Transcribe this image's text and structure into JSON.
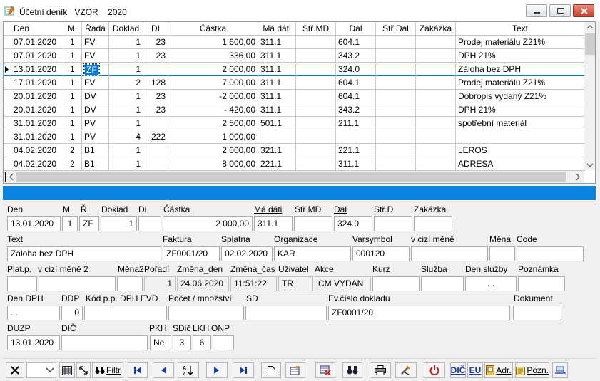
{
  "window": {
    "title": "Účetní deník   VZOR    2020"
  },
  "grid": {
    "columns": [
      "Den",
      "M.",
      "Řada",
      "Doklad",
      "DI",
      "Částka",
      "Má dáti",
      "Stř.MD",
      "Dal",
      "Stř.Dal",
      "Zakázka",
      "Text"
    ],
    "rows": [
      [
        "07.01.2020",
        "1",
        "FV",
        "1",
        "23",
        "1 600,00",
        "311.1",
        "",
        "604.1",
        "",
        "",
        "Prodej materiálu Z21%"
      ],
      [
        "07.01.2020",
        "1",
        "FV",
        "1",
        "23",
        "336,00",
        "311.1",
        "",
        "343.2",
        "",
        "",
        "DPH 21%"
      ],
      [
        "13.01.2020",
        "1",
        "ZF",
        "1",
        "",
        "2 000,00",
        "311.1",
        "",
        "324.0",
        "",
        "",
        "Záloha bez DPH"
      ],
      [
        "17.01.2020",
        "1",
        "FV",
        "2",
        "128",
        "7 000,00",
        "311.1",
        "",
        "604.1",
        "",
        "",
        "Prodej materiálu Z21%"
      ],
      [
        "20.01.2020",
        "1",
        "DV",
        "1",
        "23",
        "-2 000,00",
        "311.1",
        "",
        "604.1",
        "",
        "",
        "Dobropis vydaný Z21%"
      ],
      [
        "20.01.2020",
        "1",
        "DV",
        "1",
        "23",
        "- 420,00",
        "311.1",
        "",
        "343.2",
        "",
        "",
        "DPH 21%"
      ],
      [
        "31.01.2020",
        "1",
        "PV",
        "1",
        "",
        "2 500,00",
        "501.1",
        "",
        "211.1",
        "",
        "",
        "spotřební materiál"
      ],
      [
        "31.01.2020",
        "1",
        "PV",
        "4",
        "222",
        "1 000,00",
        "",
        "",
        "",
        "",
        "",
        ""
      ],
      [
        "04.02.2020",
        "2",
        "B1",
        "1",
        "",
        "2 000,00",
        "321.1",
        "",
        "221.1",
        "",
        "",
        "LEROS"
      ],
      [
        "04.02.2020",
        "2",
        "B1",
        "1",
        "",
        "8 000,00",
        "221.1",
        "",
        "311.1",
        "",
        "",
        "ADRESA"
      ]
    ],
    "selected_row": 2
  },
  "form": {
    "labels": {
      "den": "Den",
      "m": "M.",
      "r": "Ř.",
      "doklad": "Doklad",
      "di": "Di",
      "castka": "Částka",
      "madati": "Má dáti",
      "strmd": "Stř.MD",
      "dal": "Dal",
      "strd": "Stř.D",
      "zakazka": "Zakázka",
      "text": "Text",
      "faktura": "Faktura",
      "splatna": "Splatna",
      "organizace": "Organizace",
      "varsymbol": "Varsymbol",
      "vcizimene": "v cizí měně",
      "mena": "Měna",
      "code": "Code",
      "platp": "Plat.p.",
      "vcizimene2": "v cizí měně 2",
      "mena2": "Měna2",
      "poradi": "Pořadí",
      "zmena_den": "Změna_den",
      "zmena_cas": "Změna_čas",
      "uzivatel": "Uživatel",
      "akce": "Akce",
      "kurz": "Kurz",
      "sluzba": "Služba",
      "den_sluzby": "Den služby",
      "poznamka": "Poznámka",
      "den_dph": "Den DPH",
      "ddp": "DDP",
      "kod_pp": "Kód p.p. DPH EVD",
      "pocet": "Počet / množství",
      "sd": "SD",
      "ev_cislo": "Ev.číslo dokladu",
      "dokument": "Dokument",
      "duzp": "DUZP",
      "dic": "DIČ",
      "pkh": "PKH",
      "sdic": "SDič",
      "lkh": "LKH",
      "onp": "ONP"
    },
    "values": {
      "den": "13.01.2020",
      "m": "1",
      "r": "ZF",
      "doklad": "1",
      "di": "",
      "castka": "2 000,00",
      "madati": "311.1",
      "strmd": "",
      "dal": "324.0",
      "strd": "",
      "zakazka": "",
      "text": "Záloha bez DPH",
      "faktura": "ZF0001/20",
      "splatna": "02.02.2020",
      "organizace": "KAR",
      "varsymbol": "000120",
      "vcizimene": "",
      "mena": "",
      "code": "",
      "platp": "",
      "vcizimene2": "",
      "mena2": "",
      "poradi": "1",
      "zmena_den": "24.06.2020",
      "zmena_cas": "11:51:22",
      "uzivatel": "TR",
      "akce": "CM VYDAN",
      "kurz": "",
      "sluzba": "",
      "den_sluzby": " .  .",
      "poznamka": "",
      "den_dph": " .  .",
      "ddp": "0",
      "kod_pp": "",
      "pocet": "",
      "sd": "",
      "ev_cislo": "ZF0001/20",
      "dokument": "",
      "duzp": "13.01.2020",
      "dic": "",
      "pkh": "Ne",
      "sdic": "3",
      "lkh": "6",
      "onp": ""
    }
  },
  "toolbar": {
    "filter_label": "Filtr",
    "dic_label": "DIČ",
    "eu_label": "EU",
    "adr_label": "Adr.",
    "pozn_label": "Pozn."
  },
  "colors": {
    "band": "#0a84e0",
    "selection": "#0078d7",
    "close": "#c7402b"
  }
}
